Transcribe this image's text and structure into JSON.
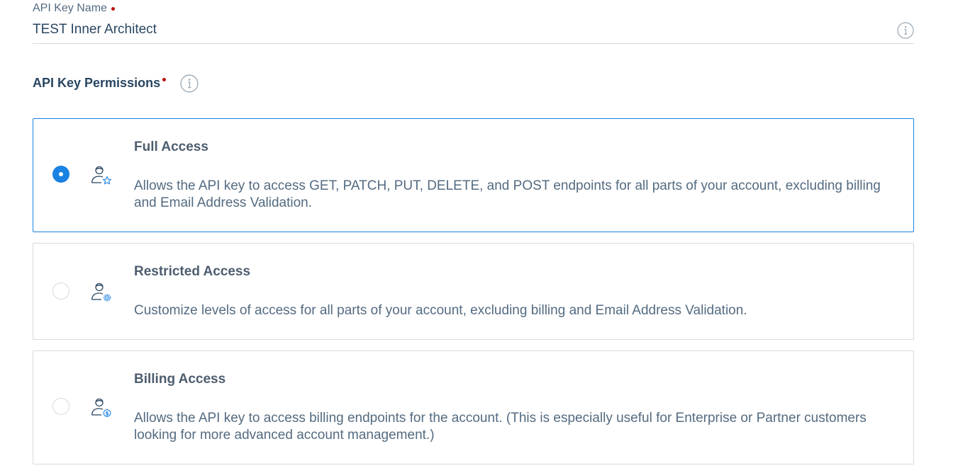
{
  "api_key_name": {
    "label": "API Key Name",
    "value": "TEST Inner Architect",
    "info_icon": "info-icon"
  },
  "permissions": {
    "heading": "API Key Permissions",
    "info_icon": "info-icon",
    "selected": "full-access",
    "options": [
      {
        "id": "full-access",
        "title": "Full Access",
        "description": "Allows the API key to access GET, PATCH, PUT, DELETE, and POST endpoints for all parts of your account, excluding billing and Email Address Validation.",
        "icon": "user-star-icon",
        "checked": true
      },
      {
        "id": "restricted-access",
        "title": "Restricted Access",
        "description": "Customize levels of access for all parts of your account, excluding billing and Email Address Validation.",
        "icon": "user-gear-icon",
        "checked": false
      },
      {
        "id": "billing-access",
        "title": "Billing Access",
        "description": "Allows the API key to access billing endpoints for the account. (This is especially useful for Enterprise or Partner customers looking for more advanced account management.)",
        "icon": "user-dollar-icon",
        "checked": false
      }
    ]
  },
  "colors": {
    "accent": "#1a82e2",
    "required": "#b80f0f",
    "heading": "#294661",
    "body_text": "#546b81",
    "border": "#d4dadf"
  }
}
